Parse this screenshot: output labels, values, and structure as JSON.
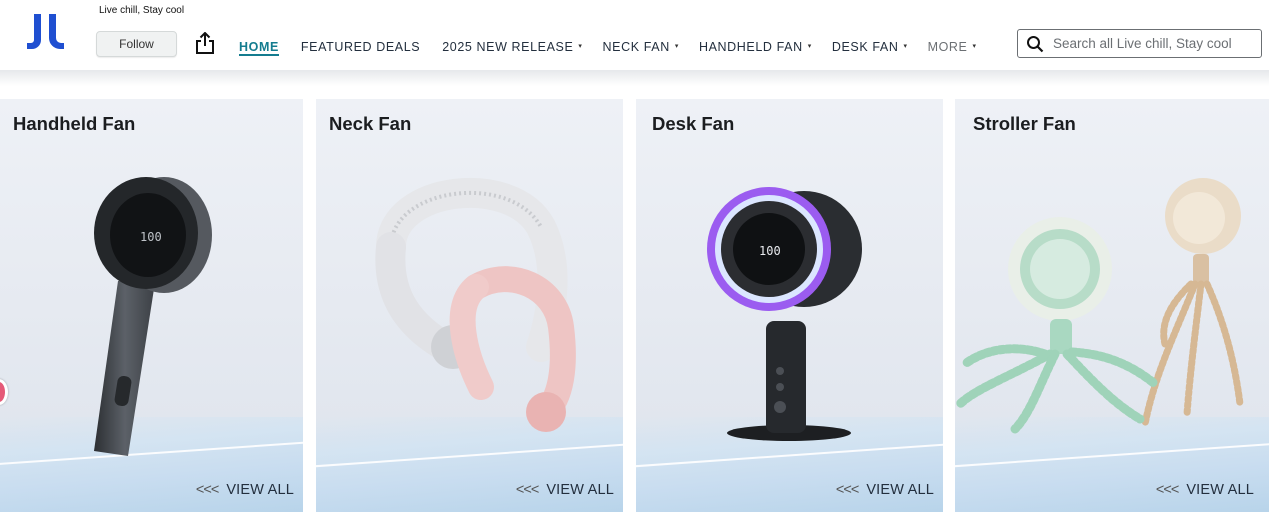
{
  "store": {
    "tagline": "Live chill, Stay cool",
    "follow_label": "Follow"
  },
  "nav": {
    "items": [
      {
        "label": "HOME",
        "active": true,
        "dropdown": false
      },
      {
        "label": "FEATURED DEALS",
        "active": false,
        "dropdown": false
      },
      {
        "label": "2025 NEW RELEASE",
        "active": false,
        "dropdown": true
      },
      {
        "label": "NECK FAN",
        "active": false,
        "dropdown": true
      },
      {
        "label": "HANDHELD FAN",
        "active": false,
        "dropdown": true
      },
      {
        "label": "DESK FAN",
        "active": false,
        "dropdown": true
      },
      {
        "label": "MORE",
        "active": false,
        "dropdown": true
      }
    ],
    "caret": "▾"
  },
  "search": {
    "placeholder": "Search all Live chill, Stay cool",
    "value": ""
  },
  "cards": [
    {
      "title": "Handheld Fan",
      "view_all": "VIEW ALL",
      "arrows": "<<<"
    },
    {
      "title": "Neck Fan",
      "view_all": "VIEW ALL",
      "arrows": "<<<"
    },
    {
      "title": "Desk Fan",
      "view_all": "VIEW ALL",
      "arrows": "<<<"
    },
    {
      "title": "Stroller Fan",
      "view_all": "VIEW ALL",
      "arrows": "<<<"
    }
  ],
  "colors": {
    "logo": "#1f4fd1",
    "accent": "#147c8f",
    "desk_ring": "#9b5cf0"
  }
}
